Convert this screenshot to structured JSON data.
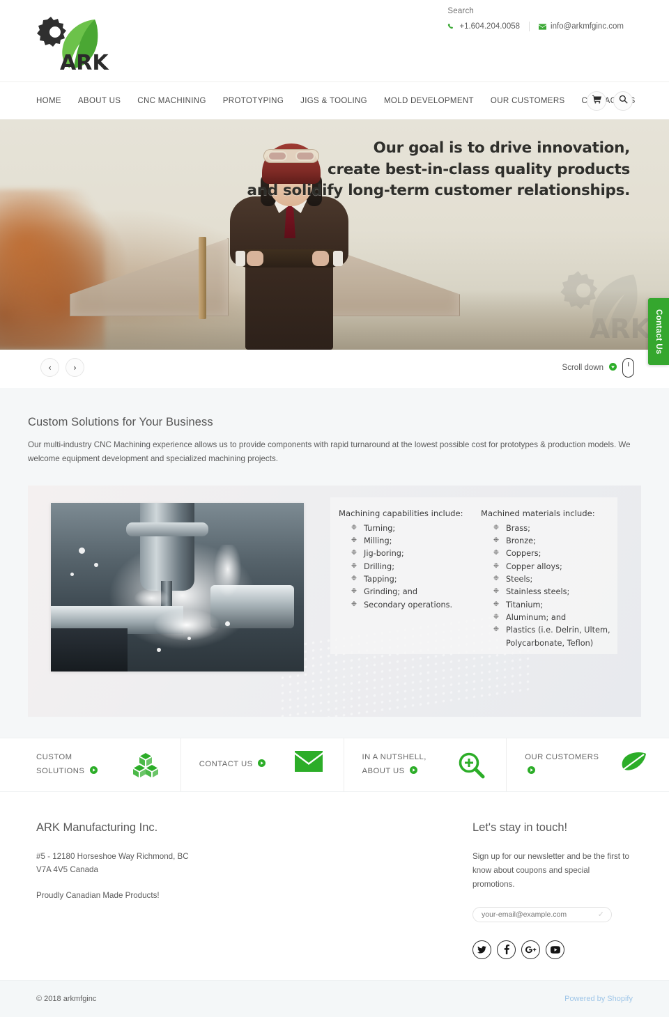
{
  "header": {
    "logo_text": "ARK",
    "search_label": "Search",
    "phone": "+1.604.204.0058",
    "email": "info@arkmfginc.com",
    "phone_icon": "phone-icon",
    "email_icon": "envelope-icon",
    "accent_color": "#3ba935"
  },
  "nav": {
    "items": [
      {
        "label": "HOME"
      },
      {
        "label": "ABOUT US"
      },
      {
        "label": "CNC MACHINING"
      },
      {
        "label": "PROTOTYPING"
      },
      {
        "label": "JIGS & TOOLING"
      },
      {
        "label": "MOLD DEVELOPMENT"
      },
      {
        "label": "OUR CUSTOMERS"
      },
      {
        "label": "CONTACT US"
      }
    ],
    "cart_icon": "shopping-cart-icon",
    "search_icon": "search-icon"
  },
  "hero": {
    "line1": "Our goal is to drive innovation,",
    "line2": "create best-in-class quality products",
    "line3": "and solidify long-term customer relationships.",
    "prev_label": "‹",
    "next_label": "›",
    "scroll_label": "Scroll down"
  },
  "side_tab": {
    "label": "Contact Us",
    "color": "#35a72e"
  },
  "solutions": {
    "title": "Custom Solutions for Your Business",
    "body": "Our multi-industry CNC Machining experience allows us to provide components with rapid turnaround at the lowest possible cost for prototypes & production models.  We welcome equipment development and specialized machining projects.",
    "capabilities_heading": "Machining capabilities include:",
    "capabilities": [
      "Turning;",
      "Milling;",
      "Jig-boring;",
      "Drilling;",
      "Tapping;",
      "Grinding; and",
      "Secondary operations."
    ],
    "materials_heading": "Machined materials include:",
    "materials": [
      "Brass;",
      "Bronze;",
      "Coppers;",
      "Copper alloys;",
      "Steels;",
      "Stainless steels;",
      "Titanium;",
      "Aluminum; and",
      "Plastics (i.e. Delrin, Ultem,"
    ],
    "materials_cont": "Polycarbonate, Teflon)"
  },
  "features": [
    {
      "label_line1": "CUSTOM",
      "label_line2": "SOLUTIONS",
      "icon": "boxes-icon"
    },
    {
      "label_line1": "CONTACT US",
      "label_line2": "",
      "icon": "envelope-icon"
    },
    {
      "label_line1": "IN A NUTSHELL,",
      "label_line2": "ABOUT US",
      "icon": "magnifier-plus-icon"
    },
    {
      "label_line1": "OUR CUSTOMERS",
      "label_line2": "",
      "icon": "leaf-icon"
    }
  ],
  "footer": {
    "company": "ARK Manufacturing Inc.",
    "address_line1": "#5 - 12180 Horseshoe Way Richmond, BC",
    "address_line2": "V7A 4V5 Canada",
    "tagline": "Proudly Canadian Made Products!",
    "newsletter_title": "Let's stay in touch!",
    "newsletter_text": "Sign up for our newsletter and be the first to know about coupons and special promotions.",
    "email_placeholder": "your-email@example.com",
    "email_value": "",
    "social": [
      {
        "name": "twitter",
        "glyph": "🐦"
      },
      {
        "name": "facebook",
        "glyph": "f"
      },
      {
        "name": "googleplus",
        "glyph": "g+"
      },
      {
        "name": "youtube",
        "glyph": "▶"
      }
    ]
  },
  "bottom": {
    "copyright": "© 2018 arkmfginc",
    "powered_by": "Powered by Shopify"
  }
}
